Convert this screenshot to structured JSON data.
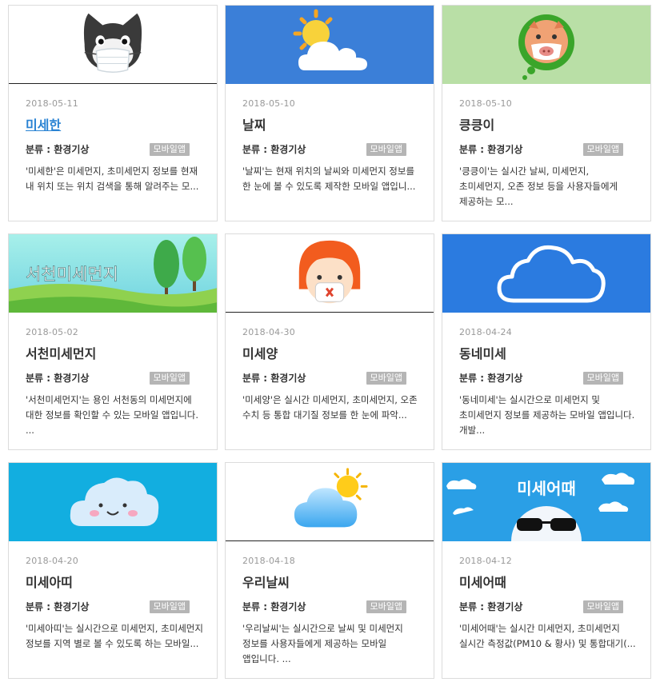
{
  "cards": [
    {
      "date": "2018-05-11",
      "title": "미세한",
      "category": "분류 : 환경기상",
      "badge": "모바일앱",
      "desc": "'미세한'은 미세먼지, 초미세먼지 정보를 현재 내 위치 또는 위치 검색을 통해 알려주는 모...",
      "image": "cat-with-mask-icon",
      "image_bg": "#ffffff"
    },
    {
      "date": "2018-05-10",
      "title": "날찌",
      "category": "분류 : 환경기상",
      "badge": "모바일앱",
      "desc": "'날찌'는 현재 위치의 날씨와 미세먼지 정보를 한 눈에 볼 수 있도록 제작한 모바일 앱입니...",
      "image": "sun-cloud-icon",
      "image_bg": "#3b7fd8"
    },
    {
      "date": "2018-05-10",
      "title": "킁킁이",
      "category": "분류 : 환경기상",
      "badge": "모바일앱",
      "desc": "'킁킁이'는 실시간 날씨, 미세먼지, 초미세먼지, 오존 정보 등을 사용자들에게 제공하는 모...",
      "image": "pig-with-mask-icon",
      "image_bg": "#b9dfa6"
    },
    {
      "date": "2018-05-02",
      "title": "서천미세먼지",
      "category": "분류 : 환경기상",
      "badge": "모바일앱",
      "desc": "'서천미세먼지'는 용인 서천동의 미세먼지에 대한 정보를 확인할 수 있는 모바일 앱입니다. ...",
      "image": "hills-trees-banner",
      "image_text": "서천미세먼지",
      "image_bg": "#88dde4"
    },
    {
      "date": "2018-04-30",
      "title": "미세양",
      "category": "분류 : 환경기상",
      "badge": "모바일앱",
      "desc": "'미세양'은 실시간 미세먼지, 초미세먼지, 오존 수치 등 통합 대기질 정보를 한 눈에 파악...",
      "image": "girl-with-mask-icon",
      "image_bg": "#ffffff"
    },
    {
      "date": "2018-04-24",
      "title": "동네미세",
      "category": "분류 : 환경기상",
      "badge": "모바일앱",
      "desc": "'동네미세'는 실시간으로 미세먼지 및 초미세먼지 정보를 제공하는 모바일 앱입니다. 개발...",
      "image": "cloud-outline-icon",
      "image_bg": "#2b7be0"
    },
    {
      "date": "2018-04-20",
      "title": "미세아띠",
      "category": "분류 : 환경기상",
      "badge": "모바일앱",
      "desc": "'미세아띠'는 실시간으로 미세먼지, 초미세먼지 정보를 지역 별로 볼 수 있도록 하는 모바일...",
      "image": "smiling-cloud-icon",
      "image_bg": "#12aee0"
    },
    {
      "date": "2018-04-18",
      "title": "우리날씨",
      "category": "분류 : 환경기상",
      "badge": "모바일앱",
      "desc": "'우리날씨'는 실시간으로 날씨 및 미세먼지 정보를 사용자들에게 제공하는 모바일 앱입니다. ...",
      "image": "cloud-sun-icon",
      "image_bg": "#ffffff"
    },
    {
      "date": "2018-04-12",
      "title": "미세어때",
      "category": "분류 : 환경기상",
      "badge": "모바일앱",
      "desc": "'미세어때'는 실시간 미세먼지, 초미세먼지 실시간 측정값(PM10 & 황사) 및 통합대기(...",
      "image": "face-sunglasses-banner",
      "image_text": "미세어때",
      "image_bg": "#2a9fe6"
    }
  ],
  "active_title_index": 0,
  "colors": {
    "link_active": "#2a83d3",
    "badge_bg": "#b5b5b5",
    "date": "#999999"
  }
}
